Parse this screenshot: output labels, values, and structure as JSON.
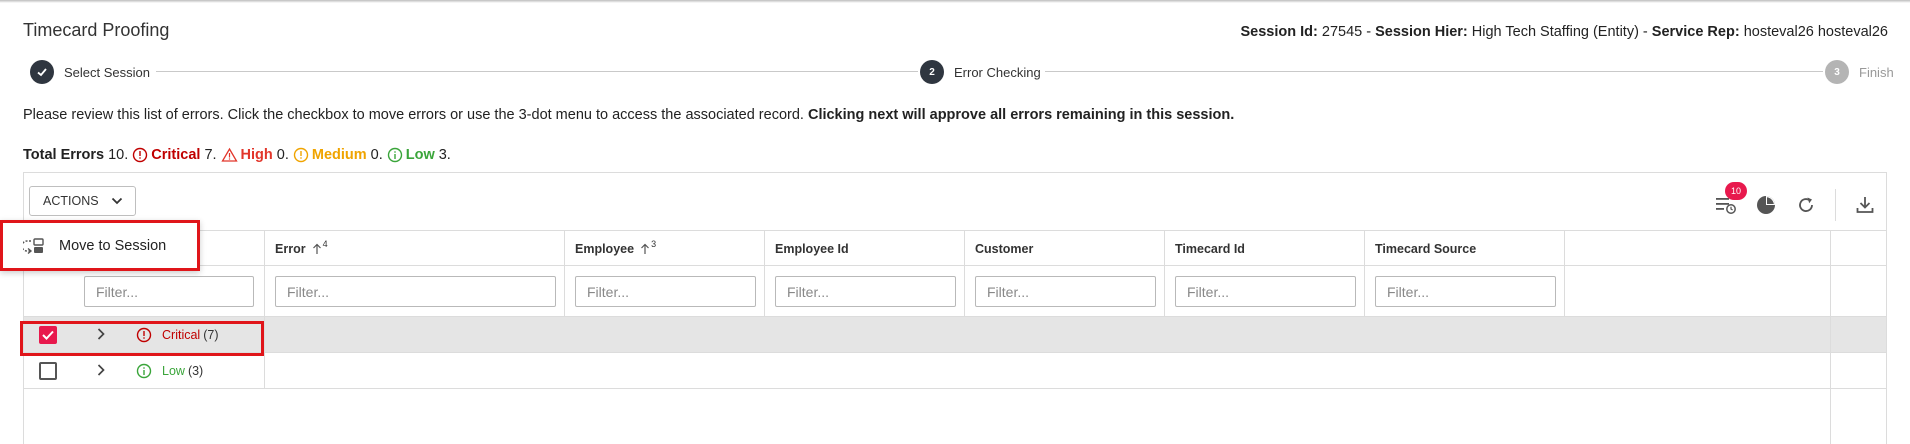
{
  "page": {
    "title": "Timecard Proofing"
  },
  "session": {
    "id_label": "Session Id:",
    "id_value": "27545",
    "sep1": " - ",
    "hier_label": "Session Hier:",
    "hier_value": "High Tech Staffing (Entity)",
    "sep2": " - ",
    "rep_label": "Service Rep:",
    "rep_value": "hosteval26 hosteval26"
  },
  "stepper": {
    "steps": [
      {
        "number": "✓",
        "label": "Select Session",
        "state": "done"
      },
      {
        "number": "2",
        "label": "Error Checking",
        "state": "active"
      },
      {
        "number": "3",
        "label": "Finish",
        "state": "pending"
      }
    ]
  },
  "instructions": {
    "text": "Please review this list of errors. Click the checkbox to move errors or use the 3-dot menu to access the associated record.",
    "bold": "Clicking next will approve all errors remaining in this session."
  },
  "totals": {
    "label": "Total Errors",
    "total": "10.",
    "critical_label": "Critical",
    "critical": "7.",
    "high_label": "High",
    "high": "0.",
    "medium_label": "Medium",
    "medium": "0.",
    "low_label": "Low",
    "low": "3."
  },
  "toolbar": {
    "actions_label": "ACTIONS",
    "badge_count": "10",
    "icons": [
      "list-clock-icon",
      "pie-chart-icon",
      "refresh-icon",
      "download-icon"
    ]
  },
  "columns": [
    {
      "label": "Error",
      "sort_rank": "4"
    },
    {
      "label": "Employee",
      "sort_rank": "3"
    },
    {
      "label": "Employee Id"
    },
    {
      "label": "Customer"
    },
    {
      "label": "Timecard Id"
    },
    {
      "label": "Timecard Source"
    }
  ],
  "filter_placeholder": "Filter...",
  "groups": [
    {
      "label": "Critical",
      "count": "(7)",
      "checked": true
    },
    {
      "label": "Low",
      "count": "(3)",
      "checked": false
    }
  ],
  "popup": {
    "label": "Move to Session"
  },
  "colors": {
    "accent": "#e8194d",
    "critical": "#c00000",
    "high": "#e2362b",
    "medium": "#f0a400",
    "low": "#3aa53a",
    "highlight": "#e0151a"
  }
}
